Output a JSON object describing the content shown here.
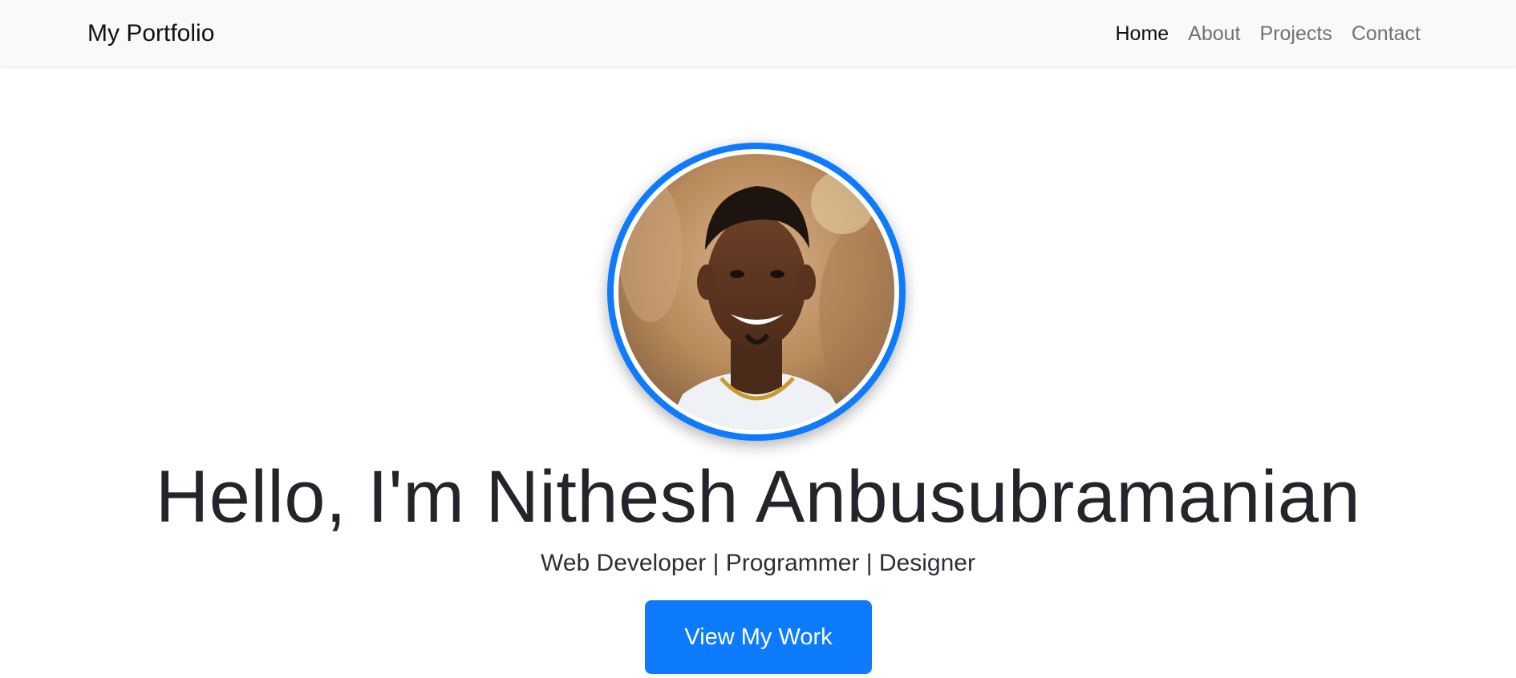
{
  "navbar": {
    "brand": "My Portfolio",
    "items": [
      {
        "label": "Home",
        "active": true
      },
      {
        "label": "About",
        "active": false
      },
      {
        "label": "Projects",
        "active": false
      },
      {
        "label": "Contact",
        "active": false
      }
    ]
  },
  "hero": {
    "avatar_icon": "profile-photo",
    "title": "Hello, I'm Nithesh Anbusubramanian",
    "subtitle": "Web Developer | Programmer | Designer",
    "cta_label": "View My Work"
  },
  "colors": {
    "accent": "#0d7bfc",
    "navbar_bg": "#f8f9fa",
    "text": "#212529"
  }
}
